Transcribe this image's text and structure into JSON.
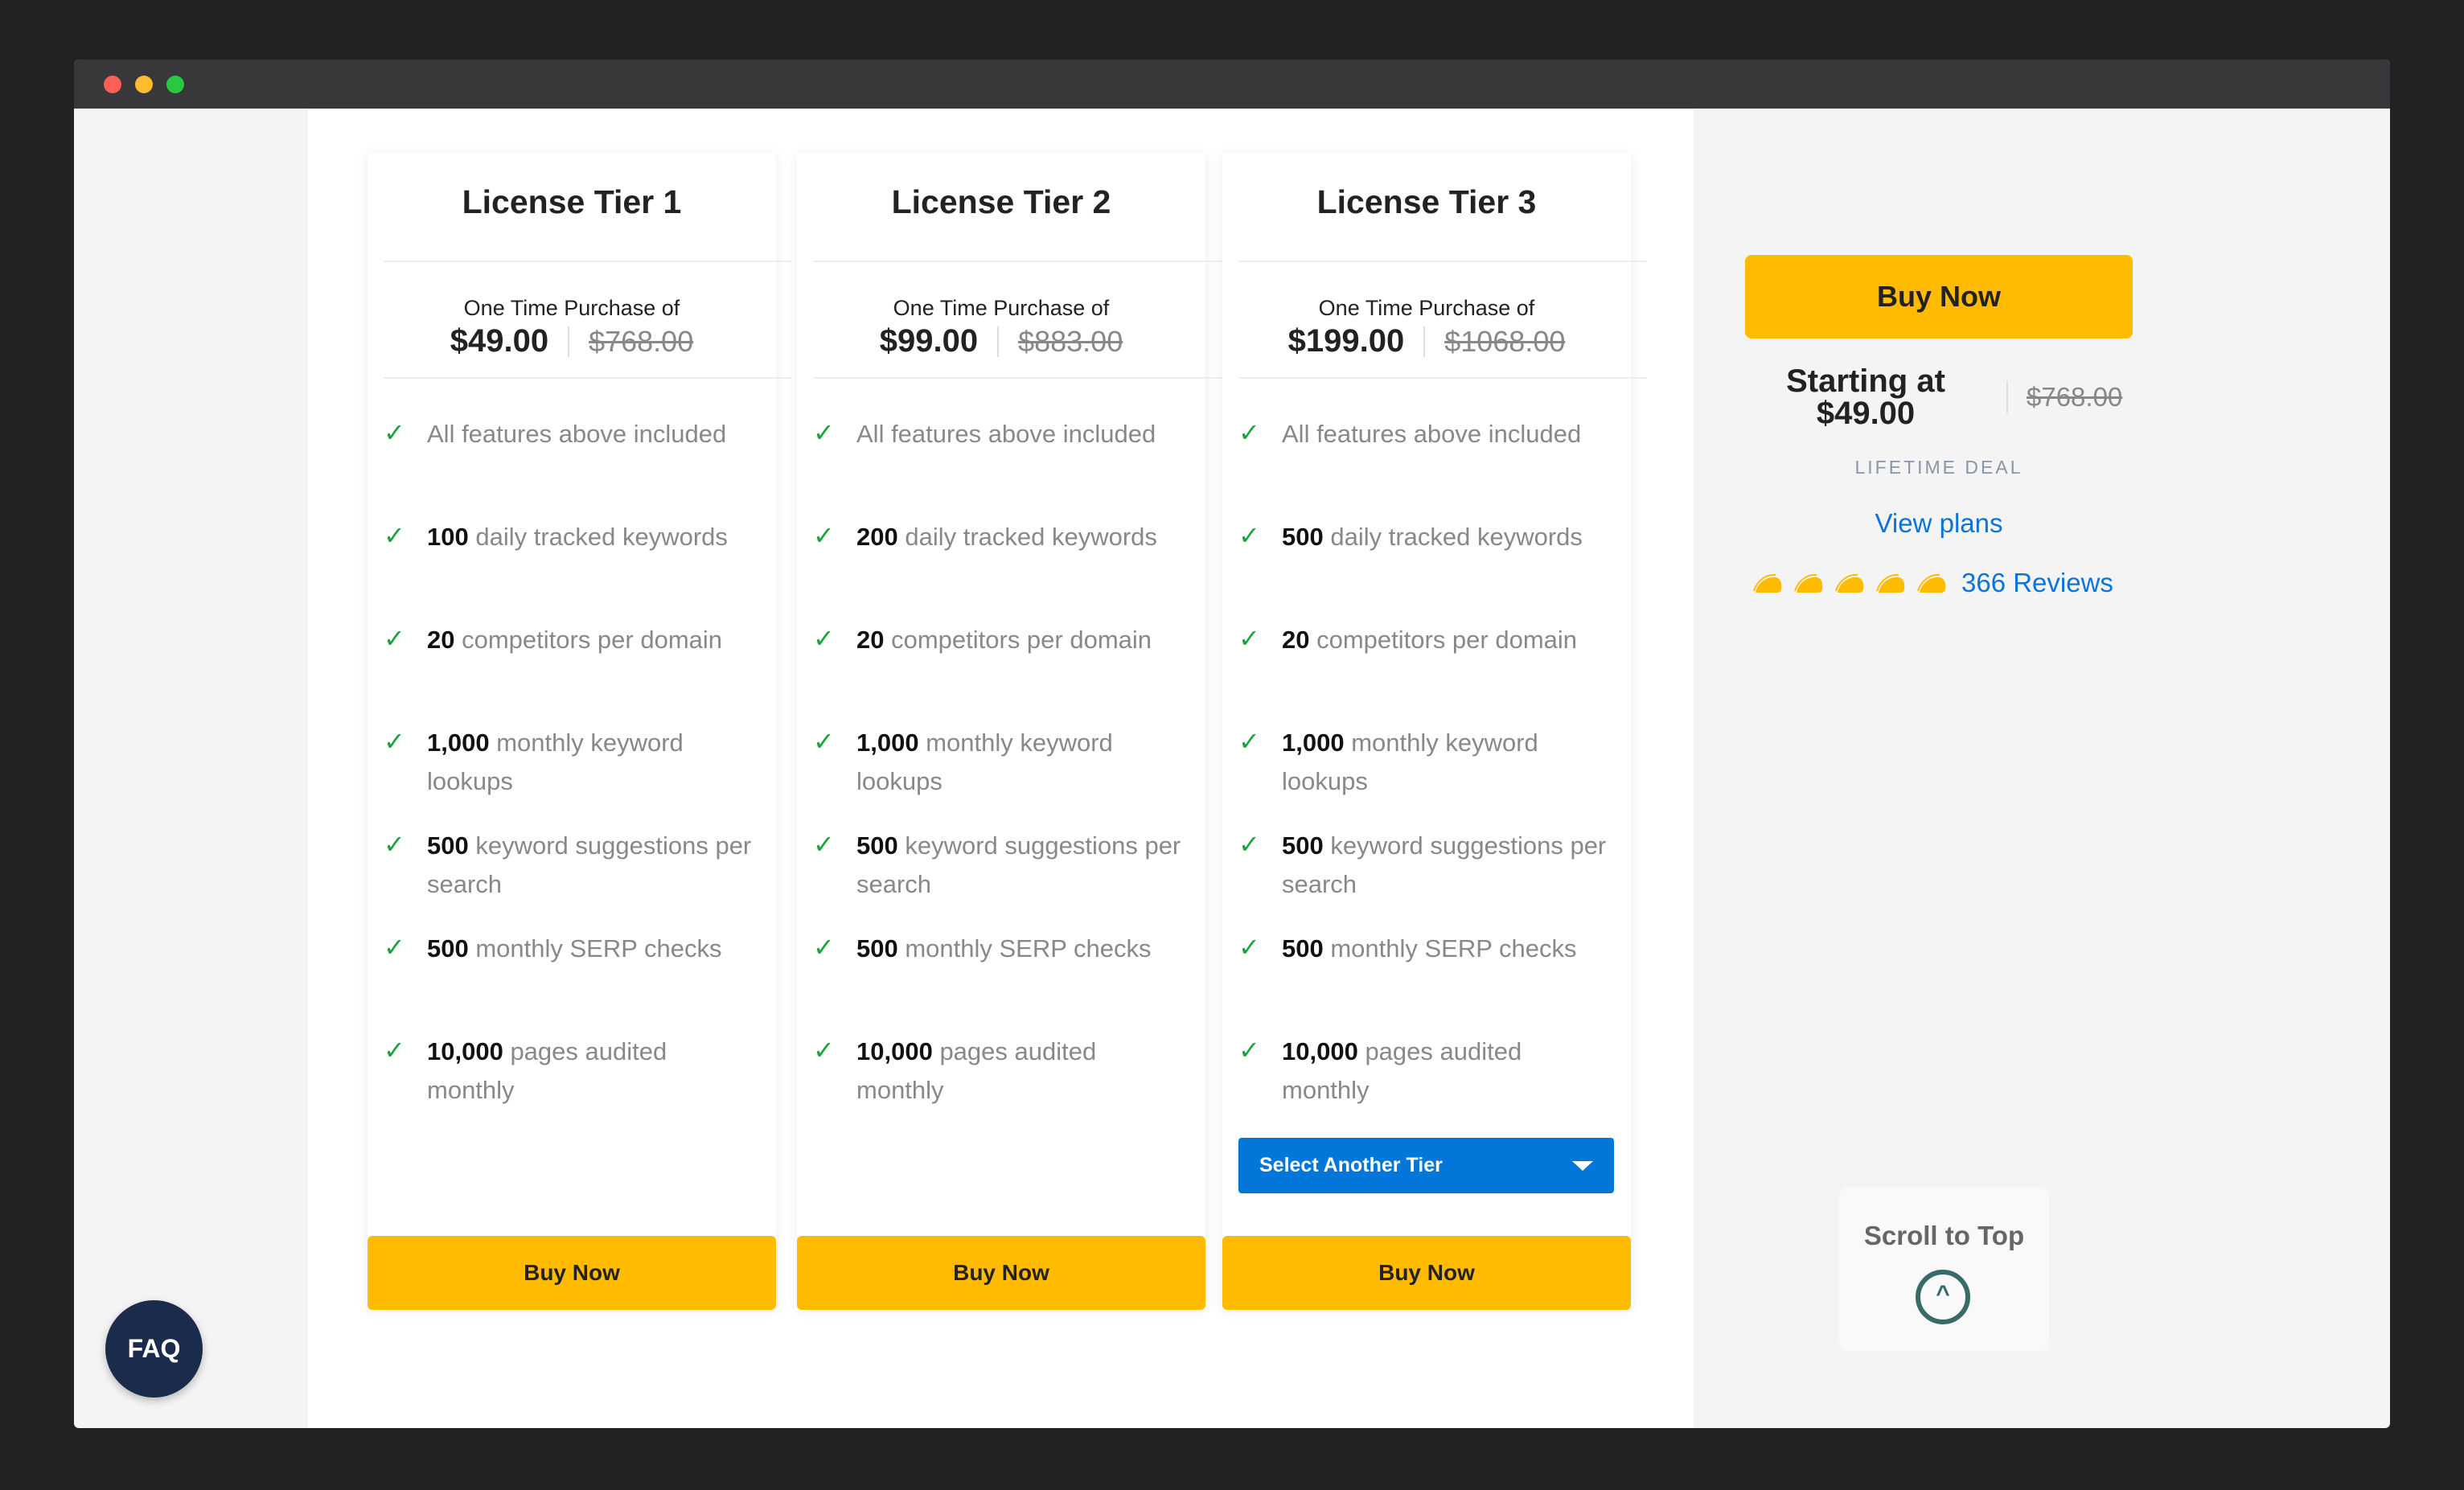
{
  "window": {
    "traffic_lights": [
      "#ff5f57",
      "#febc2e",
      "#28c840"
    ]
  },
  "tiers": [
    {
      "title": "License Tier 1",
      "purchase_label": "One Time Purchase of",
      "price": "$49.00",
      "old_price": "$768.00",
      "features": [
        {
          "bold": "",
          "text": "All features above included"
        },
        {
          "bold": "100",
          "text": " daily tracked keywords"
        },
        {
          "bold": "20",
          "text": " competitors per domain"
        },
        {
          "bold": "1,000",
          "text": " monthly keyword lookups"
        },
        {
          "bold": "500",
          "text": " keyword suggestions per search"
        },
        {
          "bold": "500",
          "text": " monthly SERP checks"
        },
        {
          "bold": "10,000",
          "text": " pages audited monthly"
        }
      ],
      "buy_label": "Buy Now"
    },
    {
      "title": "License Tier 2",
      "purchase_label": "One Time Purchase of",
      "price": "$99.00",
      "old_price": "$883.00",
      "features": [
        {
          "bold": "",
          "text": "All features above included"
        },
        {
          "bold": "200",
          "text": " daily tracked keywords"
        },
        {
          "bold": "20",
          "text": " competitors per domain"
        },
        {
          "bold": "1,000",
          "text": " monthly keyword lookups"
        },
        {
          "bold": "500",
          "text": " keyword suggestions per search"
        },
        {
          "bold": "500",
          "text": " monthly SERP checks"
        },
        {
          "bold": "10,000",
          "text": " pages audited monthly"
        }
      ],
      "buy_label": "Buy Now"
    },
    {
      "title": "License Tier 3",
      "purchase_label": "One Time Purchase of",
      "price": "$199.00",
      "old_price": "$1068.00",
      "features": [
        {
          "bold": "",
          "text": "All features above included"
        },
        {
          "bold": "500",
          "text": " daily tracked keywords"
        },
        {
          "bold": "20",
          "text": " competitors per domain"
        },
        {
          "bold": "1,000",
          "text": " monthly keyword lookups"
        },
        {
          "bold": "500",
          "text": " keyword suggestions per search"
        },
        {
          "bold": "500",
          "text": " monthly SERP checks"
        },
        {
          "bold": "10,000",
          "text": " pages audited monthly"
        }
      ],
      "select_label": "Select Another Tier",
      "buy_label": "Buy Now"
    }
  ],
  "sidebar": {
    "buy_label": "Buy Now",
    "starting_label": "Starting at",
    "starting_price": "$49.00",
    "old_price": "$768.00",
    "deal_label": "LIFETIME DEAL",
    "view_plans": "View plans",
    "rating": 5,
    "rating_icon": "taco-icon",
    "reviews": "366 Reviews"
  },
  "scroll_top": {
    "label": "Scroll to Top",
    "icon": "chevron-up-circle-icon"
  },
  "faq": {
    "label": "FAQ"
  },
  "colors": {
    "accent": "#ffbb00",
    "link": "#0a74da",
    "select": "#0277d9",
    "check": "#1aa33a",
    "faq": "#1a2b4c"
  }
}
